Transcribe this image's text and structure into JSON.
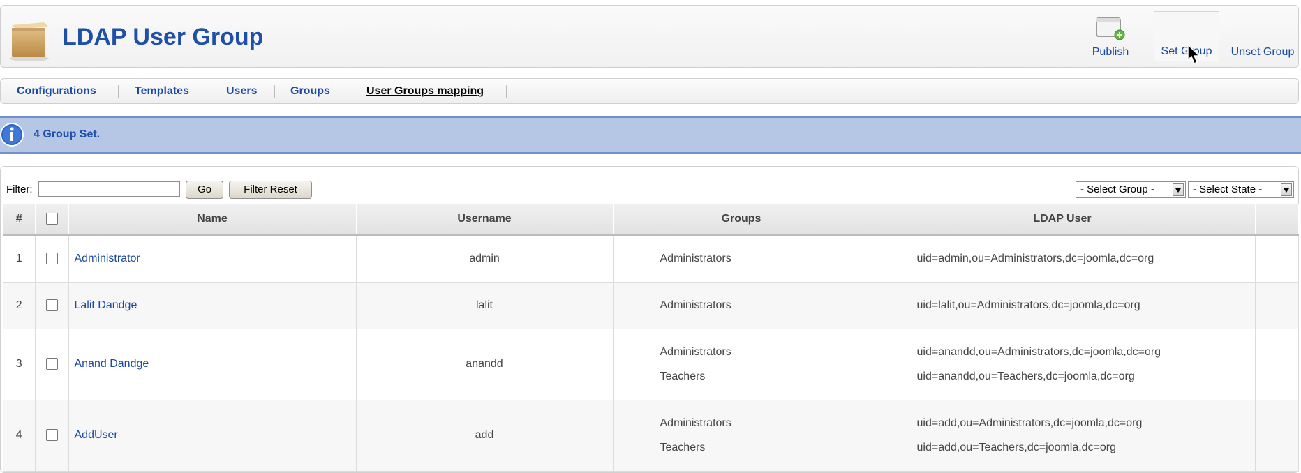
{
  "header": {
    "title": "LDAP User Group",
    "toolbar": {
      "publish_label": "Publish",
      "set_group_label": "Set Group",
      "unset_group_label": "Unset Group"
    }
  },
  "tabs": [
    {
      "label": "Configurations"
    },
    {
      "label": "Templates"
    },
    {
      "label": "Users"
    },
    {
      "label": "Groups"
    },
    {
      "label": "User Groups mapping",
      "active": true
    }
  ],
  "message": {
    "text": "4 Group Set."
  },
  "filter": {
    "label": "Filter:",
    "value": "",
    "go_label": "Go",
    "reset_label": "Filter Reset",
    "select_group": "- Select Group -",
    "select_state": "- Select State -"
  },
  "table": {
    "columns": {
      "num": "#",
      "name": "Name",
      "username": "Username",
      "groups": "Groups",
      "ldap": "LDAP User"
    },
    "rows": [
      {
        "num": "1",
        "name": "Administrator",
        "username": "admin",
        "groups": [
          "Administrators"
        ],
        "ldap": [
          "uid=admin,ou=Administrators,dc=joomla,dc=org"
        ]
      },
      {
        "num": "2",
        "name": "Lalit Dandge",
        "username": "lalit",
        "groups": [
          "Administrators"
        ],
        "ldap": [
          "uid=lalit,ou=Administrators,dc=joomla,dc=org"
        ]
      },
      {
        "num": "3",
        "name": "Anand Dandge",
        "username": "anandd",
        "groups": [
          "Administrators",
          "Teachers"
        ],
        "ldap": [
          "uid=anandd,ou=Administrators,dc=joomla,dc=org",
          "uid=anandd,ou=Teachers,dc=joomla,dc=org"
        ]
      },
      {
        "num": "4",
        "name": "AddUser",
        "username": "add",
        "groups": [
          "Administrators",
          "Teachers"
        ],
        "ldap": [
          "uid=add,ou=Administrators,dc=joomla,dc=org",
          "uid=add,ou=Teachers,dc=joomla,dc=org"
        ]
      }
    ]
  },
  "colors": {
    "link": "#1a4aa3",
    "title": "#1f4fa6",
    "message_bg": "#b5c7e4",
    "message_border": "#6f8fd0"
  }
}
